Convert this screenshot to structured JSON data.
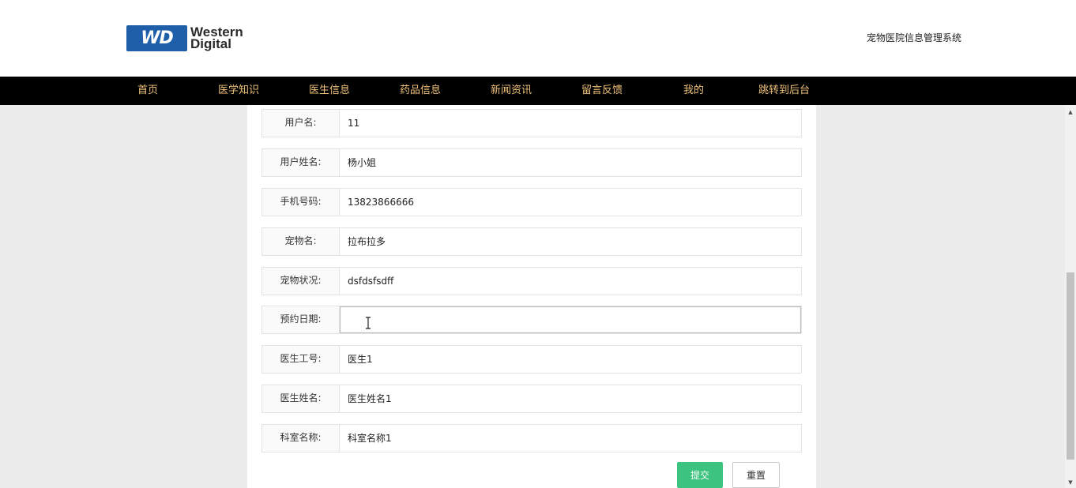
{
  "header": {
    "logo_mark": "WD",
    "logo_line1": "Western",
    "logo_line2": "Digital",
    "system_title": "宠物医院信息管理系统"
  },
  "nav": {
    "items": [
      {
        "label": "首页"
      },
      {
        "label": "医学知识"
      },
      {
        "label": "医生信息"
      },
      {
        "label": "药品信息"
      },
      {
        "label": "新闻资讯"
      },
      {
        "label": "留言反馈"
      },
      {
        "label": "我的"
      },
      {
        "label": "跳转到后台"
      }
    ]
  },
  "form": {
    "fields": [
      {
        "label": "用户名:",
        "value": "11"
      },
      {
        "label": "用户姓名:",
        "value": "杨小姐"
      },
      {
        "label": "手机号码:",
        "value": "13823866666"
      },
      {
        "label": "宠物名:",
        "value": "拉布拉多"
      },
      {
        "label": "宠物状况:",
        "value": "dsfdsfsdff"
      },
      {
        "label": "预约日期:",
        "value": ""
      },
      {
        "label": "医生工号:",
        "value": "医生1"
      },
      {
        "label": "医生姓名:",
        "value": "医生姓名1"
      },
      {
        "label": "科室名称:",
        "value": "科室名称1"
      }
    ],
    "submit_label": "提交",
    "reset_label": "重置"
  },
  "colors": {
    "nav_bg": "#000000",
    "nav_text": "#f0c27a",
    "submit_bg": "#3cc37f",
    "logo_blue": "#1f5fa9"
  }
}
